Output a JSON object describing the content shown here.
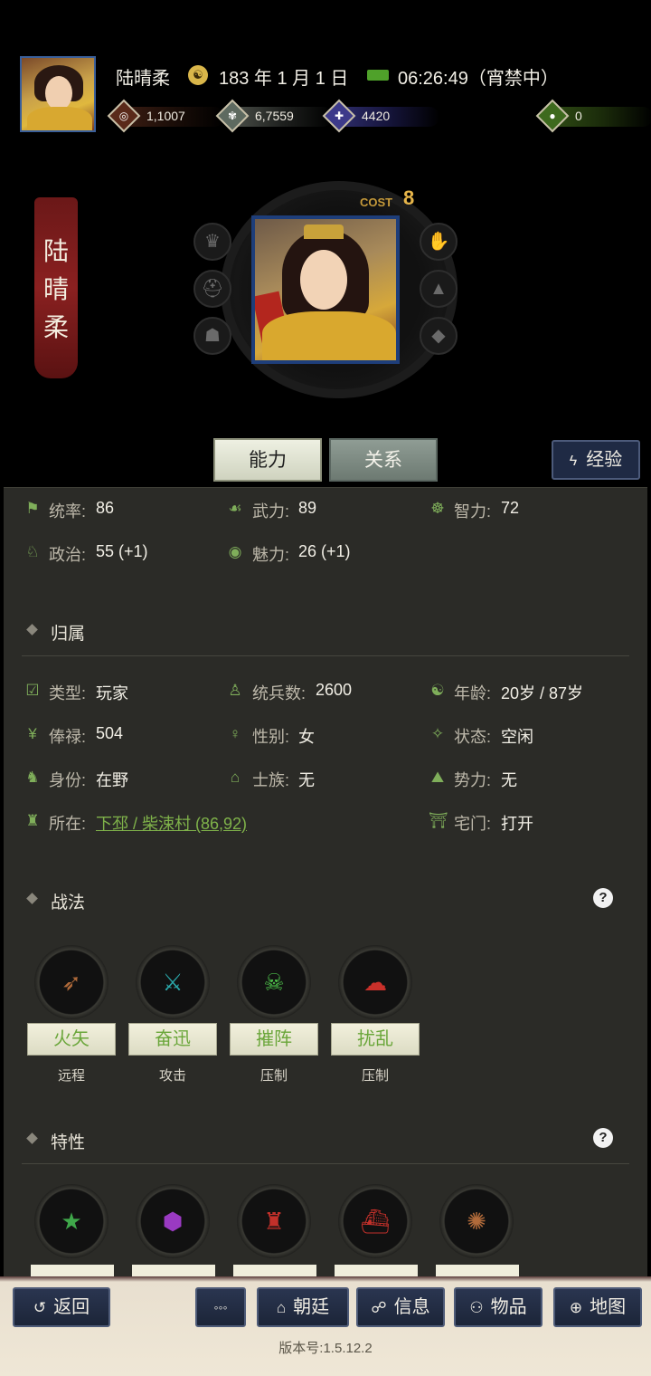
{
  "header": {
    "player_name": "陆晴柔",
    "date_icon": "calendar-seal-icon",
    "date": "183 年 1 月 1 日",
    "time_icon": "horse-icon",
    "time": "06:26:49（宵禁中）",
    "resources": [
      {
        "icon": "coin-icon",
        "value": "1,1007"
      },
      {
        "icon": "grain-icon",
        "value": "6,7559"
      },
      {
        "icon": "soldier-icon",
        "value": "4420"
      },
      {
        "icon": "money-bag-icon",
        "value": "0"
      }
    ]
  },
  "profile": {
    "name_chars": [
      "陆",
      "晴",
      "柔"
    ],
    "cost_label": "COST",
    "cost_value": "8",
    "left_orbs": [
      "crown-icon",
      "helmet-icon",
      "mask-icon"
    ],
    "right_orbs": [
      "hand-icon",
      "hat-icon",
      "graduation-cap-icon"
    ]
  },
  "tabs": {
    "ability": "能力",
    "relation": "关系",
    "experience": "经验"
  },
  "stats": [
    {
      "label": "统率:",
      "value": "86"
    },
    {
      "label": "武力:",
      "value": "89"
    },
    {
      "label": "智力:",
      "value": "72"
    },
    {
      "label": "政治:",
      "value": "55 (+1)"
    },
    {
      "label": "魅力:",
      "value": "26 (+1)"
    }
  ],
  "belonging": {
    "title": "归属",
    "rows": [
      {
        "label": "类型:",
        "value": "玩家"
      },
      {
        "label": "统兵数:",
        "value": "2600"
      },
      {
        "label": "年龄:",
        "value": "20岁 / 87岁"
      },
      {
        "label": "俸禄:",
        "value": "504"
      },
      {
        "label": "性别:",
        "value": "女"
      },
      {
        "label": "状态:",
        "value": "空闲"
      },
      {
        "label": "身份:",
        "value": "在野"
      },
      {
        "label": "士族:",
        "value": "无"
      },
      {
        "label": "势力:",
        "value": "无"
      },
      {
        "label": "所在:",
        "value": "下邳 / 柴涑村 (86,92)"
      },
      {
        "label": "宅门:",
        "value": "打开"
      }
    ]
  },
  "tactics": {
    "title": "战法",
    "help": "?",
    "items": [
      {
        "name": "火矢",
        "type": "远程",
        "icon": "fire-arrow-icon"
      },
      {
        "name": "奋迅",
        "type": "攻击",
        "icon": "crossed-swords-icon"
      },
      {
        "name": "摧阵",
        "type": "压制",
        "icon": "break-formation-icon"
      },
      {
        "name": "扰乱",
        "type": "压制",
        "icon": "confusion-cloud-icon"
      }
    ]
  },
  "traits": {
    "title": "特性",
    "help": "?",
    "items": [
      {
        "icon": "star-helmet-icon"
      },
      {
        "icon": "rock-icon"
      },
      {
        "icon": "armor-icon"
      },
      {
        "icon": "warship-icon"
      },
      {
        "icon": "explosion-icon"
      }
    ]
  },
  "bottom": {
    "back": "返回",
    "more": "◦◦◦",
    "court": "朝廷",
    "info": "信息",
    "items": "物品",
    "map": "地图",
    "version": "版本号:1.5.12.2"
  }
}
